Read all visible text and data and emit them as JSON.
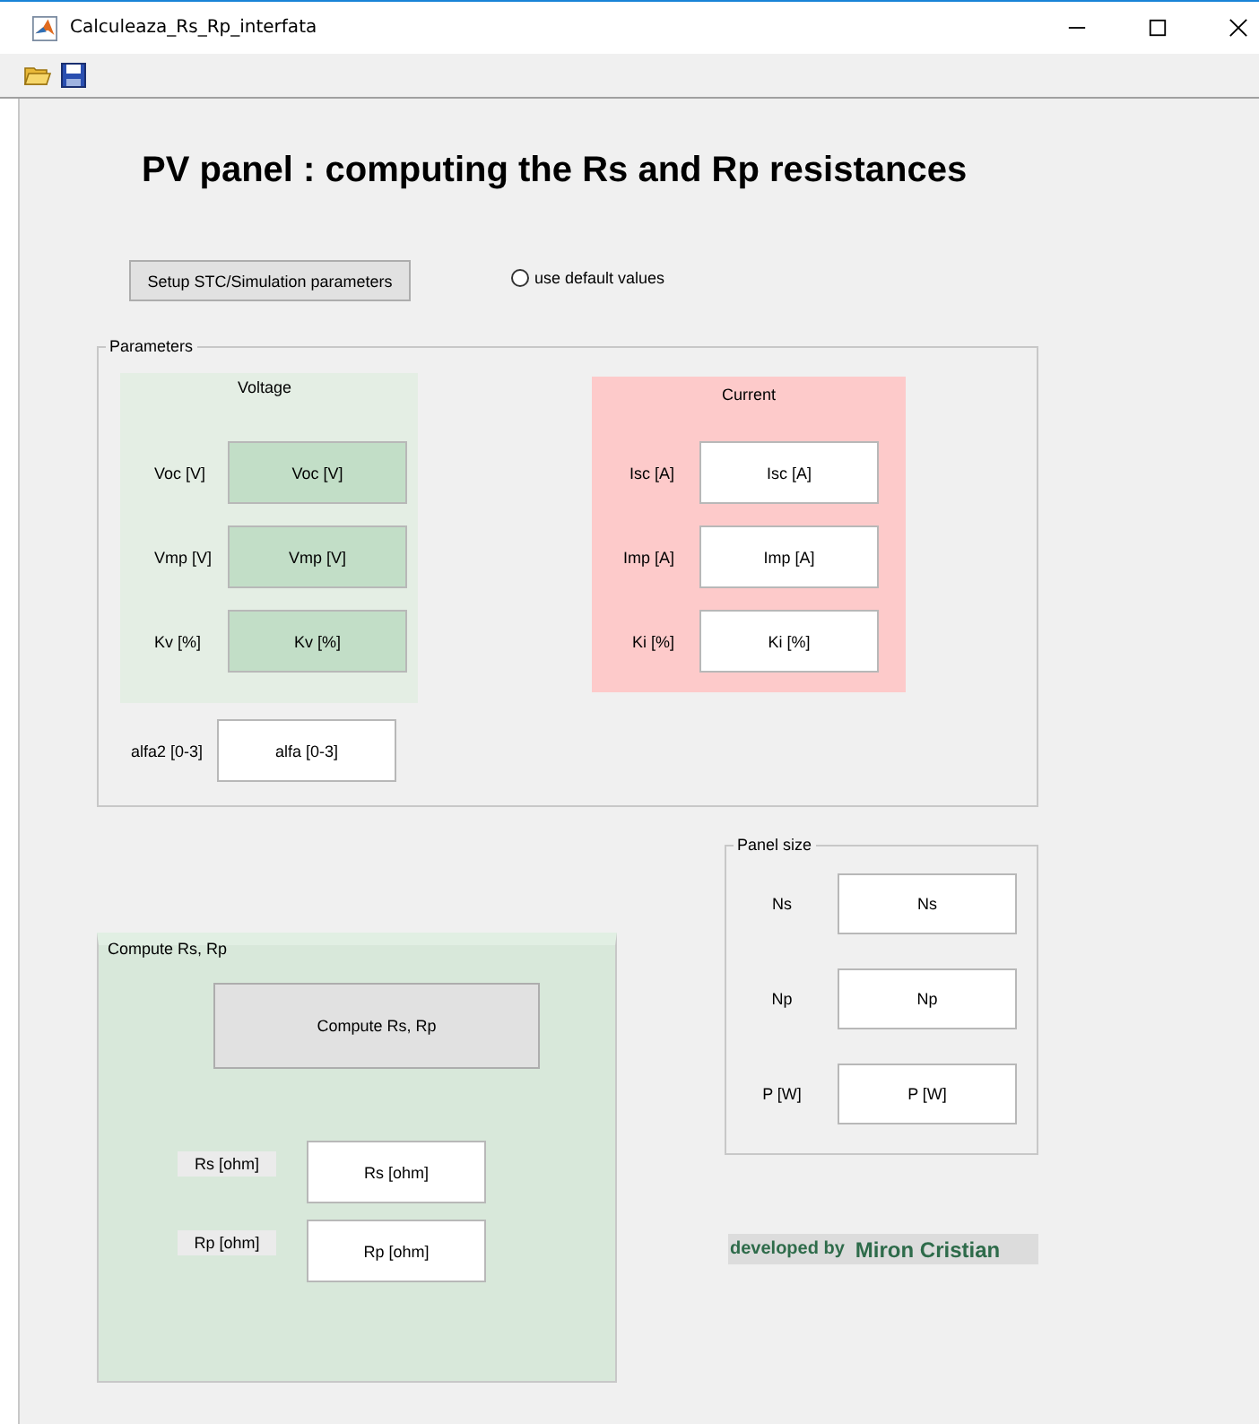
{
  "window": {
    "title": "Calculeaza_Rs_Rp_interfata"
  },
  "toolbar": [
    {
      "kind": "open"
    },
    {
      "kind": "save"
    }
  ],
  "heading": "PV panel : computing the Rs and Rp resistances",
  "setup_button": "Setup STC/Simulation parameters",
  "default_values": {
    "label": "use default values",
    "selected": false
  },
  "parameters": {
    "title": "Parameters",
    "voltage": {
      "title": "Voltage",
      "rows": [
        {
          "label": "Voc [V]",
          "value": "Voc [V]"
        },
        {
          "label": "Vmp [V]",
          "value": "Vmp [V]"
        },
        {
          "label": "Kv [%]",
          "value": "Kv [%]"
        }
      ]
    },
    "current": {
      "title": "Current",
      "rows": [
        {
          "label": "Isc [A]",
          "value": "Isc [A]"
        },
        {
          "label": "Imp [A]",
          "value": "Imp [A]"
        },
        {
          "label": "Ki [%]",
          "value": "Ki [%]"
        }
      ]
    },
    "alfa": {
      "label": "alfa2 [0-3]",
      "value": "alfa [0-3]"
    }
  },
  "compute": {
    "title": "Compute Rs, Rp",
    "button": "Compute Rs, Rp",
    "results": [
      {
        "label": "Rs [ohm]",
        "value": "Rs [ohm]"
      },
      {
        "label": "Rp [ohm]",
        "value": "Rp [ohm]"
      }
    ]
  },
  "panel_size": {
    "title": "Panel size",
    "rows": [
      {
        "label": "Ns",
        "value": "Ns"
      },
      {
        "label": "Np",
        "value": "Np"
      },
      {
        "label": "P [W]",
        "value": "P [W]"
      }
    ]
  },
  "credit": {
    "prefix": "developed by",
    "name": "Miron Cristian"
  }
}
